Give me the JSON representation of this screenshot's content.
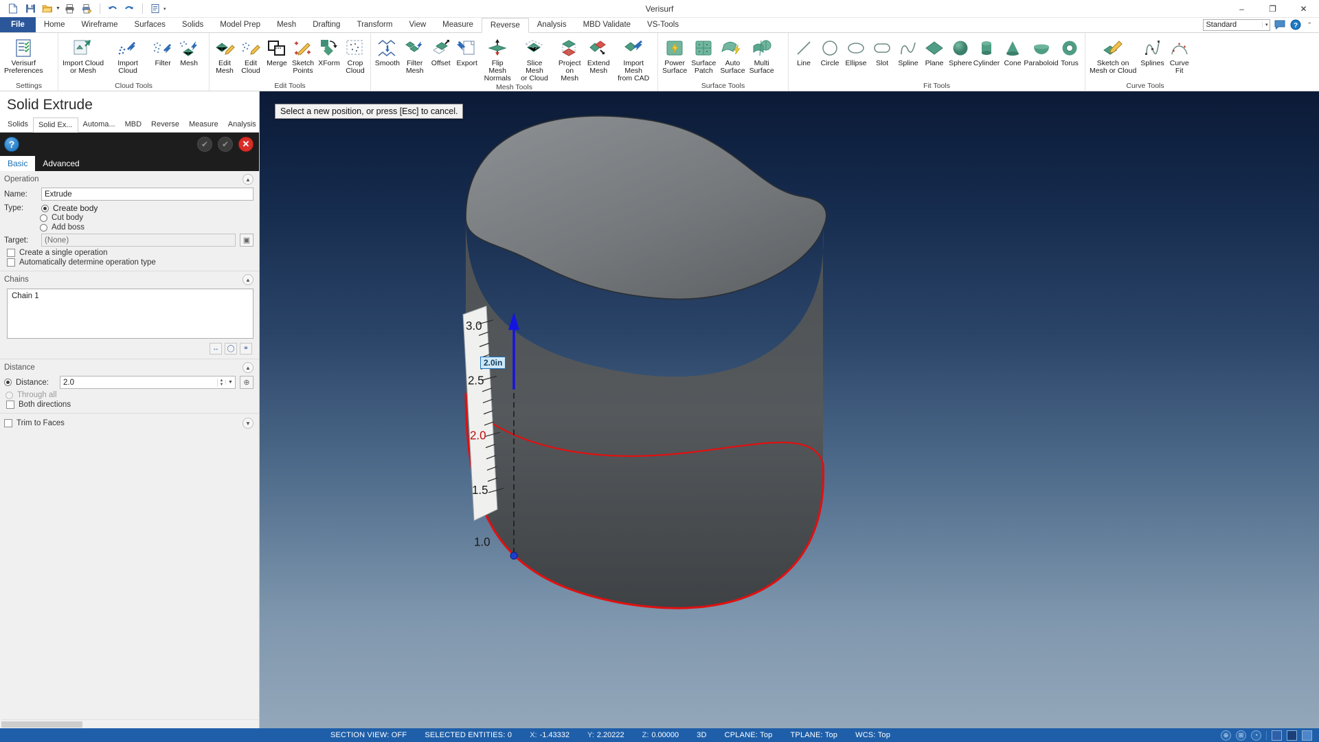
{
  "window": {
    "title": "Verisurf",
    "minimize": "–",
    "maximize": "❐",
    "close": "✕"
  },
  "quick_access": [
    {
      "name": "new-file-icon",
      "label": "New"
    },
    {
      "name": "save-icon",
      "label": "Save"
    },
    {
      "name": "open-folder-icon",
      "label": "Open"
    },
    {
      "name": "print-icon",
      "label": "Print"
    },
    {
      "name": "print-preview-icon",
      "label": "Print Preview"
    },
    {
      "name": "undo-icon",
      "label": "Undo"
    },
    {
      "name": "redo-icon",
      "label": "Redo"
    },
    {
      "name": "report-icon",
      "label": "Report"
    },
    {
      "name": "customize-qat-icon",
      "label": "Customize Quick Access Toolbar"
    }
  ],
  "ribbon": {
    "tabs": [
      {
        "label": "File",
        "active": false,
        "file": true
      },
      {
        "label": "Home",
        "active": false
      },
      {
        "label": "Wireframe",
        "active": false
      },
      {
        "label": "Surfaces",
        "active": false
      },
      {
        "label": "Solids",
        "active": false
      },
      {
        "label": "Model Prep",
        "active": false
      },
      {
        "label": "Mesh",
        "active": false
      },
      {
        "label": "Drafting",
        "active": false
      },
      {
        "label": "Transform",
        "active": false
      },
      {
        "label": "View",
        "active": false
      },
      {
        "label": "Measure",
        "active": false
      },
      {
        "label": "Reverse",
        "active": true
      },
      {
        "label": "Analysis",
        "active": false
      },
      {
        "label": "MBD Validate",
        "active": false
      },
      {
        "label": "VS-Tools",
        "active": false
      }
    ],
    "style_selector": {
      "value": "Standard",
      "arrow": "▾"
    },
    "help_icon": "help-icon",
    "comment_icon": "comment-icon",
    "collapse_icon": "⌃",
    "groups": [
      {
        "label": "Settings",
        "items": [
          {
            "label": "Verisurf\nPreferences",
            "icon": "preferences-icon"
          }
        ]
      },
      {
        "label": "Cloud Tools",
        "items": [
          {
            "label": "Import Cloud\nor Mesh",
            "icon": "import-cloud-or-mesh-icon"
          },
          {
            "label": "Import\nCloud",
            "icon": "import-cloud-icon"
          },
          {
            "label": "Filter",
            "icon": "filter-cloud-icon"
          },
          {
            "label": "Mesh",
            "icon": "mesh-icon"
          }
        ]
      },
      {
        "label": "Edit Tools",
        "items": [
          {
            "label": "Edit\nMesh",
            "icon": "edit-mesh-icon"
          },
          {
            "label": "Edit\nCloud",
            "icon": "edit-cloud-icon"
          },
          {
            "label": "Merge",
            "icon": "merge-icon"
          },
          {
            "label": "Sketch\nPoints",
            "icon": "sketch-points-icon"
          },
          {
            "label": "XForm",
            "icon": "xform-icon"
          },
          {
            "label": "Crop\nCloud",
            "icon": "crop-cloud-icon"
          }
        ]
      },
      {
        "label": "Mesh Tools",
        "items": [
          {
            "label": "Smooth",
            "icon": "smooth-icon"
          },
          {
            "label": "Filter\nMesh",
            "icon": "filter-mesh-icon"
          },
          {
            "label": "Offset",
            "icon": "offset-icon"
          },
          {
            "label": "Export",
            "icon": "export-icon"
          },
          {
            "label": "Flip Mesh\nNormals",
            "icon": "flip-mesh-normals-icon"
          },
          {
            "label": "Slice Mesh\nor Cloud",
            "icon": "slice-mesh-or-cloud-icon"
          },
          {
            "label": "Project\non Mesh",
            "icon": "project-on-mesh-icon"
          },
          {
            "label": "Extend\nMesh",
            "icon": "extend-mesh-icon"
          },
          {
            "label": "Import Mesh\nfrom CAD",
            "icon": "import-mesh-from-cad-icon"
          }
        ]
      },
      {
        "label": "Surface Tools",
        "items": [
          {
            "label": "Power\nSurface",
            "icon": "power-surface-icon"
          },
          {
            "label": "Surface\nPatch",
            "icon": "surface-patch-icon"
          },
          {
            "label": "Auto\nSurface",
            "icon": "auto-surface-icon"
          },
          {
            "label": "Multi\nSurface",
            "icon": "multi-surface-icon"
          }
        ]
      },
      {
        "label": "Fit Tools",
        "items": [
          {
            "label": "Line",
            "icon": "line-icon"
          },
          {
            "label": "Circle",
            "icon": "circle-icon"
          },
          {
            "label": "Ellipse",
            "icon": "ellipse-icon"
          },
          {
            "label": "Slot",
            "icon": "slot-icon"
          },
          {
            "label": "Spline",
            "icon": "spline-icon"
          },
          {
            "label": "Plane",
            "icon": "plane-icon"
          },
          {
            "label": "Sphere",
            "icon": "sphere-icon"
          },
          {
            "label": "Cylinder",
            "icon": "cylinder-icon"
          },
          {
            "label": "Cone",
            "icon": "cone-icon"
          },
          {
            "label": "Paraboloid",
            "icon": "paraboloid-icon"
          },
          {
            "label": "Torus",
            "icon": "torus-icon"
          }
        ]
      },
      {
        "label": "Curve Tools",
        "items": [
          {
            "label": "Sketch on\nMesh or Cloud",
            "icon": "sketch-on-mesh-or-cloud-icon"
          },
          {
            "label": "Splines",
            "icon": "splines-icon"
          },
          {
            "label": "Curve\nFit",
            "icon": "curve-fit-icon"
          }
        ]
      }
    ]
  },
  "panel": {
    "title": "Solid Extrude",
    "tabs": [
      {
        "label": "Solids",
        "active": false
      },
      {
        "label": "Solid Ex...",
        "active": true
      },
      {
        "label": "Automa...",
        "active": false
      },
      {
        "label": "MBD",
        "active": false
      },
      {
        "label": "Reverse",
        "active": false
      },
      {
        "label": "Measure",
        "active": false
      },
      {
        "label": "Analysis",
        "active": false
      }
    ],
    "help_label": "?",
    "actions": [
      {
        "name": "apply-button",
        "glyph": "✔"
      },
      {
        "name": "ok-button",
        "glyph": "✔"
      },
      {
        "name": "cancel-button",
        "glyph": "✕"
      }
    ],
    "mode_tabs": [
      {
        "label": "Basic",
        "active": true
      },
      {
        "label": "Advanced",
        "active": false
      }
    ],
    "operation": {
      "section_label": "Operation",
      "name_label": "Name:",
      "name_value": "Extrude",
      "type_label": "Type:",
      "types": [
        {
          "label": "Create body",
          "selected": true
        },
        {
          "label": "Cut body",
          "selected": false
        },
        {
          "label": "Add boss",
          "selected": false
        }
      ],
      "target_label": "Target:",
      "target_value": "(None)",
      "checkboxes": [
        {
          "label": "Create a single operation",
          "checked": false
        },
        {
          "label": "Automatically determine operation type",
          "checked": false
        }
      ]
    },
    "chains": {
      "section_label": "Chains",
      "items": [
        "Chain  1"
      ],
      "tools": [
        {
          "name": "reverse-chain-button",
          "glyph": "↔"
        },
        {
          "name": "edit-chain-button",
          "glyph": "◯"
        },
        {
          "name": "link-chain-button",
          "glyph": "⚭"
        }
      ]
    },
    "distance": {
      "section_label": "Distance",
      "distance_radio_label": "Distance:",
      "distance_value": "2.0",
      "distance_selected": true,
      "through_all_label": "Through all",
      "through_all_selected": false,
      "both_directions_label": "Both directions",
      "both_directions_checked": false,
      "measure_button": "measure-distance-button"
    },
    "trim": {
      "label": "Trim to Faces",
      "checked": false
    }
  },
  "viewport": {
    "prompt": "Select a new position, or press [Esc] to cancel.",
    "dimension_label": "2.0in",
    "ruler_ticks": [
      "3.0",
      "2.5",
      "2.0",
      "1.5",
      "1.0"
    ],
    "ruler_highlight": "2.0",
    "colors": {
      "profile_curve": "#e01010",
      "solid_face": "#5a5d60",
      "axis_arrow": "#1414e0",
      "origin_point": "#1414e0"
    }
  },
  "statusbar": {
    "section_view": "SECTION VIEW: OFF",
    "selected_entities": "SELECTED ENTITIES: 0",
    "x_key": "X:",
    "x_value": "-1.43332",
    "y_key": "Y:",
    "y_value": "2.20222",
    "z_key": "Z:",
    "z_value": "0.00000",
    "mode": "3D",
    "cplane": "CPLANE: Top",
    "tplane": "TPLANE: Top",
    "wcs": "WCS: Top",
    "icons": [
      {
        "name": "globe-icon",
        "glyph": "⊕"
      },
      {
        "name": "grid-icon",
        "glyph": "⊞"
      },
      {
        "name": "view-icon",
        "glyph": "◔"
      },
      {
        "name": "color-swatch-blue",
        "color": "#2e5fa8"
      },
      {
        "name": "color-swatch-dark",
        "color": "#1b3f78"
      },
      {
        "name": "color-swatch-light",
        "color": "#4e86c9"
      }
    ]
  }
}
